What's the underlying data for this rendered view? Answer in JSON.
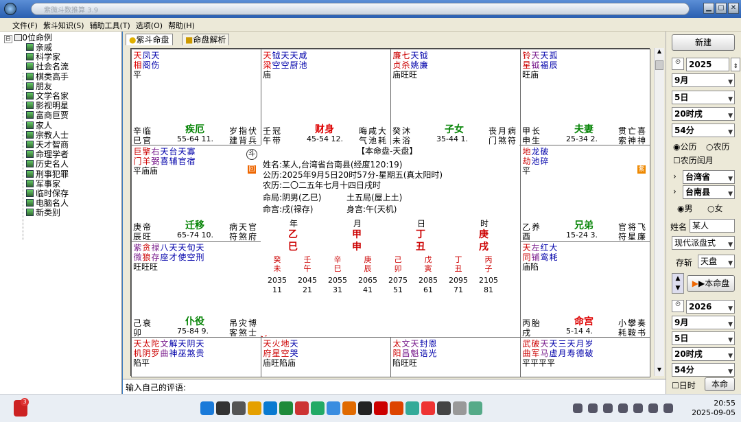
{
  "window": {
    "title": "紫微斗数推算 3.9"
  },
  "menu": [
    "文件(F)",
    "紫斗知识(S)",
    "辅助工具(T)",
    "选项(O)",
    "帮助(H)"
  ],
  "tree": {
    "root": "0位命例",
    "items": [
      "亲戚",
      "科学家",
      "社会名流",
      "棋类高手",
      "朋友",
      "文学名家",
      "影视明星",
      "富商巨贾",
      "家人",
      "宗教人士",
      "天才智商",
      "命理学者",
      "历史名人",
      "刑事犯罪",
      "军事家",
      "临时保存",
      "电脑名人",
      "新类别"
    ]
  },
  "tabs": [
    "紫斗命盘",
    "命盘解析"
  ],
  "cells": {
    "si": {
      "stars": [
        [
          "天",
          "相"
        ],
        [
          "凤",
          "阁"
        ],
        [
          "天",
          "伤"
        ]
      ],
      "colors": [
        "c-red",
        "c-blue",
        "c-blue"
      ],
      "bright": "平",
      "palace": "疾厄",
      "stem": [
        "辛",
        "巳"
      ],
      "cs": [
        "临",
        "官"
      ],
      "age": "55-64 11.",
      "gods": [
        "岁",
        "建"
      ],
      "gods2": [
        "指",
        "背"
      ],
      "gods3": [
        "伏",
        "兵"
      ]
    },
    "wu": {
      "stars": [
        [
          "天",
          "梁"
        ],
        [
          "钺",
          "空"
        ],
        [
          "天",
          "空"
        ],
        [
          "天",
          "厨"
        ],
        [
          "咸",
          "池"
        ]
      ],
      "colors": [
        "c-red",
        "c-blue",
        "c-blue",
        "c-blue",
        "c-blue"
      ],
      "bright": "庙",
      "palace": "财身",
      "stem": [
        "壬",
        "午"
      ],
      "cs": [
        "冠",
        "带"
      ],
      "age": "45-54 12.",
      "gods": [
        "晦",
        "气"
      ],
      "gods2": [
        "咸",
        "池"
      ],
      "gods3": [
        "大",
        "耗"
      ]
    },
    "wei": {
      "stars": [
        [
          "廉",
          "贞"
        ],
        [
          "七",
          "杀"
        ],
        [
          "天",
          "姚"
        ],
        [
          "钺",
          "廉"
        ]
      ],
      "colors": [
        "c-dred",
        "c-dred",
        "c-blue",
        "c-blue"
      ],
      "bright": "庙旺旺",
      "palace": "子女",
      "stem": [
        "癸",
        "未"
      ],
      "cs": [
        "沐",
        "浴"
      ],
      "age": "35-44 1.",
      "gods": [
        "丧",
        "门"
      ],
      "gods2": [
        "月",
        "煞"
      ],
      "gods3": [
        "病",
        "符"
      ]
    },
    "shen": {
      "stars": [
        [
          "铃",
          "星"
        ],
        [
          "天",
          "钺"
        ],
        [
          "天",
          "福"
        ],
        [
          "孤",
          "辰"
        ]
      ],
      "colors": [
        "c-dred",
        "c-purple",
        "c-blue",
        "c-blue"
      ],
      "bright": "旺庙",
      "palace": "夫妻",
      "stem": [
        "甲",
        "申"
      ],
      "cs": [
        "长",
        "生"
      ],
      "age": "25-34 2.",
      "gods": [
        "贯",
        "索"
      ],
      "gods2": [
        "亡",
        "神"
      ],
      "gods3": [
        "喜",
        "神"
      ]
    },
    "chen": {
      "stars": [
        [
          "巨",
          "门"
        ],
        [
          "擎",
          "羊"
        ],
        [
          "右",
          "弼"
        ],
        [
          "天",
          "喜"
        ],
        [
          "台",
          "辅"
        ],
        [
          "天",
          "官"
        ],
        [
          "寡",
          "宿"
        ]
      ],
      "colors": [
        "c-dred",
        "c-dred",
        "c-purple",
        "c-blue",
        "c-blue",
        "c-blue",
        "c-blue"
      ],
      "bright": "平庙庙",
      "palace": "迁移",
      "stem": [
        "庚",
        "辰"
      ],
      "cs": [
        "帝",
        "旺"
      ],
      "age": "65-74 10.",
      "gods": [
        "病",
        "符"
      ],
      "gods2": [
        "天",
        "煞"
      ],
      "gods3": [
        "官",
        "府"
      ]
    },
    "you": {
      "stars": [
        [
          "地",
          "劫"
        ],
        [
          "龙",
          "池"
        ],
        [
          "破",
          "碎"
        ]
      ],
      "colors": [
        "c-dred",
        "c-blue",
        "c-blue"
      ],
      "bright": "平",
      "palace": "兄弟",
      "stem": [
        "乙",
        "酉"
      ],
      "cs": [
        "养",
        ""
      ],
      "age": "15-24 3.",
      "gods": [
        "官",
        "符"
      ],
      "gods2": [
        "将",
        "星"
      ],
      "gods3": [
        "飞",
        "廉"
      ]
    },
    "mao": {
      "stars": [
        [
          "紫",
          "微"
        ],
        [
          "贪",
          "狼"
        ],
        [
          "禄",
          "存"
        ],
        [
          "八",
          "座"
        ],
        [
          "天",
          "才"
        ],
        [
          "天",
          "使"
        ],
        [
          "旬",
          "空"
        ],
        [
          "天",
          "刑"
        ]
      ],
      "colors": [
        "c-purple",
        "c-dred",
        "c-purple",
        "c-blue",
        "c-blue",
        "c-blue",
        "c-blue",
        "c-blue"
      ],
      "bright": "旺旺旺",
      "palace": "仆役",
      "stem": [
        "己",
        "卯"
      ],
      "cs": [
        "衰",
        ""
      ],
      "age": "75-84 9.",
      "gods": [
        "吊",
        "客"
      ],
      "gods2": [
        "灾",
        "煞"
      ],
      "gods3": [
        "博",
        "士"
      ]
    },
    "xu": {
      "stars": [
        [
          "天",
          "同"
        ],
        [
          "左",
          "铺"
        ],
        [
          "红",
          "鸾"
        ],
        [
          "大",
          "耗"
        ]
      ],
      "colors": [
        "c-dred",
        "c-purple",
        "c-blue",
        "c-blue"
      ],
      "bright": "庙陷",
      "palace": "命宫",
      "stem": [
        "丙",
        "戌"
      ],
      "cs": [
        "胎",
        ""
      ],
      "age": "5-14 4.",
      "gods": [
        "小",
        "耗"
      ],
      "gods2": [
        "攀",
        "鞍"
      ],
      "gods3": [
        "奏",
        "书"
      ]
    },
    "yin": {
      "stars": [
        [
          "天",
          "机"
        ],
        [
          "太",
          "阴"
        ],
        [
          "陀",
          "罗"
        ],
        [
          "文",
          "曲"
        ],
        [
          "解",
          "神"
        ],
        [
          "天",
          "巫"
        ],
        [
          "阴",
          "煞"
        ],
        [
          "天",
          "贵"
        ]
      ],
      "colors": [
        "c-dred",
        "c-dred",
        "c-dred",
        "c-purple",
        "c-blue",
        "c-blue",
        "c-blue",
        "c-blue"
      ],
      "bright": "陷平"
    },
    "chou": {
      "stars": [
        [
          "天",
          "府"
        ],
        [
          "火",
          "星"
        ],
        [
          "地",
          "空"
        ],
        [
          "天",
          "哭"
        ]
      ],
      "colors": [
        "c-dred",
        "c-dred",
        "c-dred",
        "c-blue"
      ],
      "bright": "庙旺陷庙"
    },
    "zi": {
      "stars": [
        [
          "太",
          "阳"
        ],
        [
          "文",
          "昌"
        ],
        [
          "天",
          "魁"
        ],
        [
          "封",
          "诰"
        ],
        [
          "恩",
          "光"
        ]
      ],
      "colors": [
        "c-dred",
        "c-purple",
        "c-purple",
        "c-blue",
        "c-blue"
      ],
      "bright": "陷旺旺"
    },
    "hai": {
      "stars": [
        [
          "武",
          "曲"
        ],
        [
          "破",
          "军"
        ],
        [
          "天",
          "马"
        ],
        [
          "天",
          "虚"
        ],
        [
          "三",
          "月"
        ],
        [
          "天",
          "寿"
        ],
        [
          "月",
          "德"
        ],
        [
          "岁",
          "破"
        ]
      ],
      "colors": [
        "c-dred",
        "c-dred",
        "c-purple",
        "c-blue",
        "c-blue",
        "c-blue",
        "c-blue",
        "c-blue"
      ],
      "bright": "平平平平"
    }
  },
  "center": {
    "title": "【本命盘-天盘】",
    "name": "姓名:某人,台湾省台南县(经度120:19)",
    "solar": "公历:2025年9月5日20时57分-星期五(真太阳时)",
    "lunar": "农历:二〇二五年七月十四日戌时",
    "ju": "命局:阴男(乙巳)",
    "wuxing": "土五局(屋上土)",
    "ming": "命宫:戌(禄存)",
    "shen": "身宫:午(天机)",
    "pillar_heads": [
      "年",
      "月",
      "日",
      "时"
    ],
    "pillars": [
      [
        "乙",
        "巳"
      ],
      [
        "甲",
        "申"
      ],
      [
        "丁",
        "丑"
      ],
      [
        "庚",
        "戌"
      ]
    ],
    "dayun_stems": [
      [
        "癸",
        "未"
      ],
      [
        "壬",
        "午"
      ],
      [
        "辛",
        "巳"
      ],
      [
        "庚",
        "辰"
      ],
      [
        "己",
        "卯"
      ],
      [
        "戊",
        "寅"
      ],
      [
        "丁",
        "丑"
      ],
      [
        "丙",
        "子"
      ]
    ],
    "dayun_years": [
      "2035",
      "2045",
      "2055",
      "2065",
      "2075",
      "2085",
      "2095",
      "2105"
    ],
    "dayun_ages": [
      "11",
      "21",
      "31",
      "41",
      "51",
      "61",
      "71",
      "81"
    ]
  },
  "comment_placeholder": "输入自己的评语:",
  "right": {
    "new_btn": "新建",
    "year": "2025",
    "month": "9月",
    "day": "5日",
    "hour": "20时戌",
    "minute": "54分",
    "solar": "公历",
    "lunar": "农历",
    "leap": "农历闰月",
    "province": "台湾省",
    "county": "台南县",
    "male": "男",
    "female": "女",
    "name_label": "姓名",
    "name_value": "某人",
    "style": "现代派盘式",
    "save_label": "存斩",
    "save_value": "天盘",
    "ben_btn": "▶本命盘",
    "year2": "2026",
    "month2": "9月",
    "day2": "5日",
    "hour2": "20时戌",
    "minute2": "54分",
    "rishi": "日时",
    "bening": "本命"
  },
  "taskbar": {
    "time": "20:55",
    "date": "2025-09-05",
    "badge": "3"
  }
}
